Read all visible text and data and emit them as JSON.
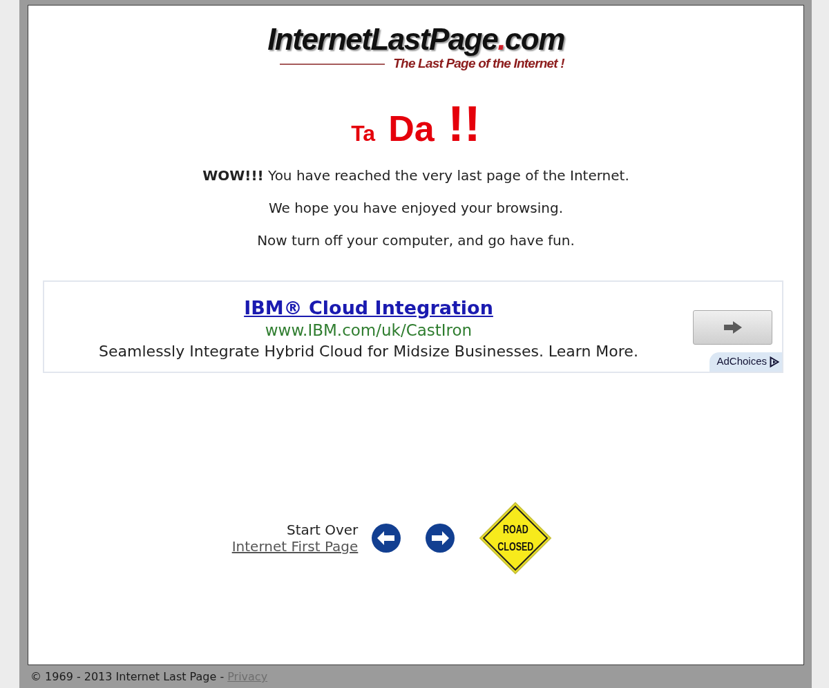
{
  "logo": {
    "name": "InternetLastPage",
    "accent": ".",
    "suffix": "com",
    "tagline": "The Last Page of the Internet !"
  },
  "heading": [
    "Ta",
    "Da",
    "!!"
  ],
  "messages": [
    "**WOW!!!** You have reached the very last page of the Internet.",
    "We hope you have enjoyed your browsing.",
    "Now turn off your computer, and go have fun."
  ],
  "ad": {
    "title": "IBM® Cloud Integration",
    "url": "www.IBM.com/uk/CastIron",
    "description": "Seamlessly Integrate Hybrid Cloud for Midsize Businesses. Learn More.",
    "badge": "AdChoices"
  },
  "navigation": {
    "label": "Start Over",
    "link": "Internet First Page",
    "sign": [
      "ROAD",
      "CLOSED"
    ]
  },
  "footer": {
    "copyright": "© 1969 - 2013 Internet Last Page -",
    "link": "Privacy"
  }
}
